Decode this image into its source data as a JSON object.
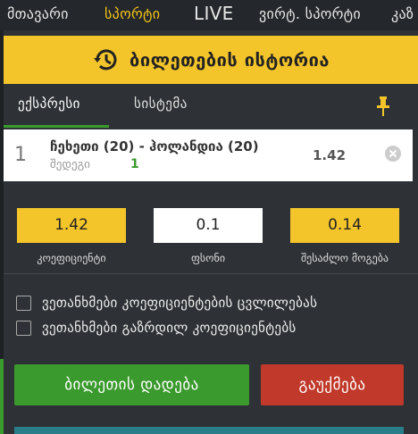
{
  "nav": {
    "items": [
      {
        "label": "მთავარი"
      },
      {
        "label": "სპორტი"
      },
      {
        "label": "LIVE"
      },
      {
        "label": "ვირტ. სპორტი"
      },
      {
        "label": "კაზ"
      }
    ],
    "active_index": 1
  },
  "history": {
    "title": "ბილეთების ისტორია",
    "icon": "history-clock-icon"
  },
  "tabs": [
    {
      "label": "ექსპრესი"
    },
    {
      "label": "სისტემა"
    }
  ],
  "bet": {
    "index": "1",
    "match": "ჩეხეთი (20) - ჰოლანდია (20)",
    "market": "შედეგი",
    "pick": "1",
    "odd": "1.42"
  },
  "stake": {
    "coefficient": {
      "value": "1.42",
      "label": "კოეფიციენტი"
    },
    "amount": {
      "value": "0.1",
      "label": "ფსონი"
    },
    "possible_win": {
      "value": "0.14",
      "label": "შესაძლო მოგება"
    }
  },
  "options": [
    {
      "label": "ვეთანხმები კოეფიციენტების ცვლილებას",
      "checked": false
    },
    {
      "label": "ვეთანხმები გაზრდილ კოეფიციენტებს",
      "checked": false
    }
  ],
  "actions": {
    "place_bet": "ბილეთის დადება",
    "cancel": "გაუქმება"
  },
  "colors": {
    "accent": "#f3c52b",
    "success": "#3b9a2e",
    "danger": "#c0392b",
    "background": "#2e3236"
  }
}
